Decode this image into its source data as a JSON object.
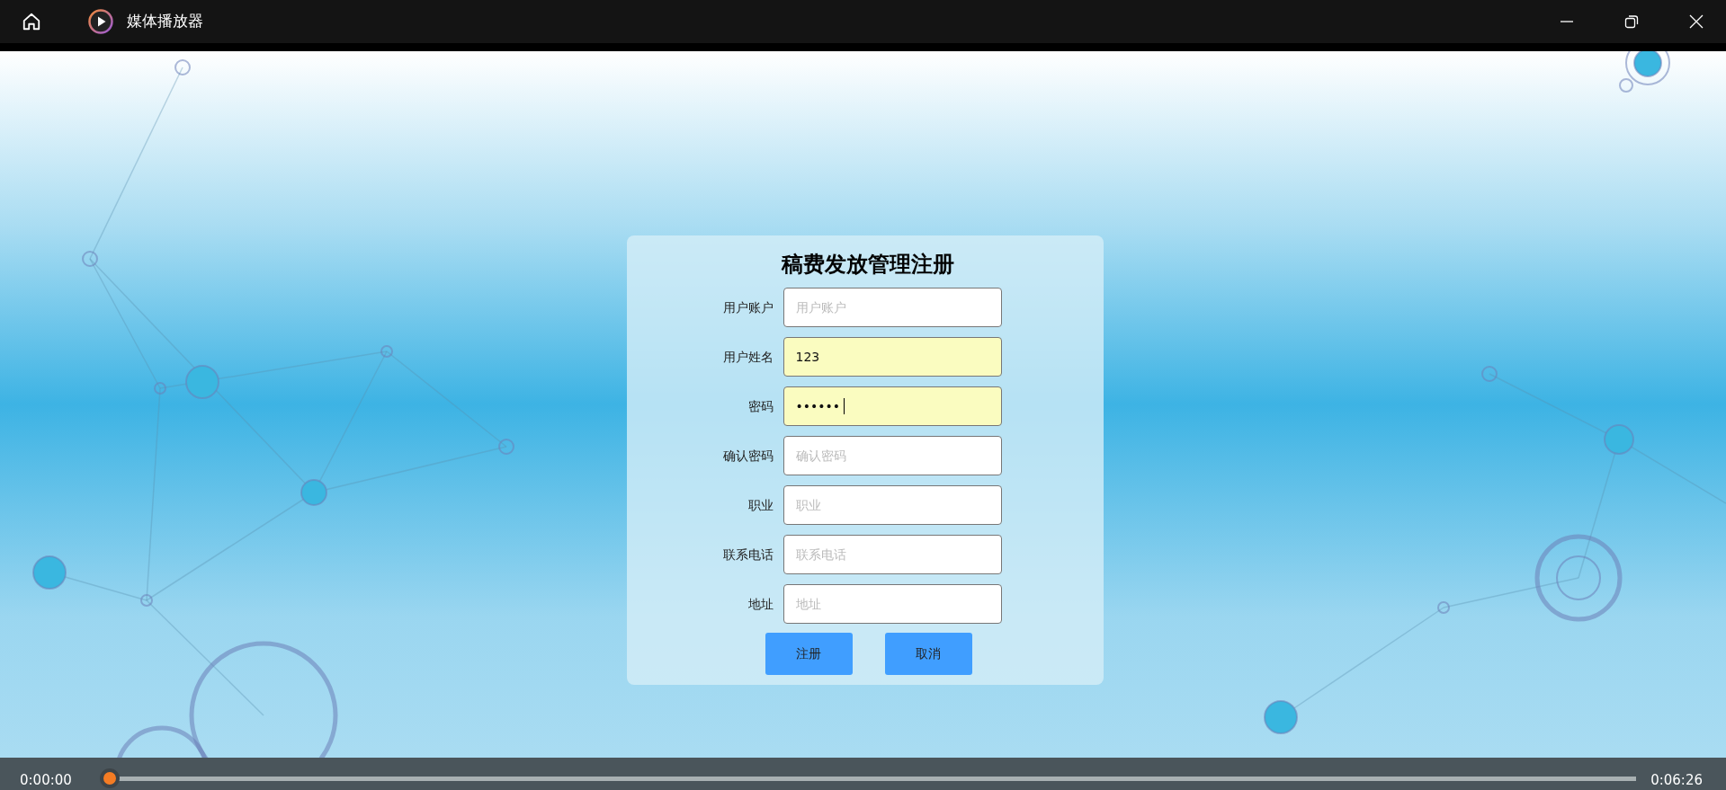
{
  "window": {
    "title": "媒体播放器"
  },
  "form": {
    "title": "稿费发放管理注册",
    "fields": [
      {
        "label": "用户账户",
        "placeholder": "用户账户",
        "autofilled": false
      },
      {
        "label": "用户姓名",
        "value": "123",
        "autofilled": true
      },
      {
        "label": "密码",
        "value": "••••••",
        "autofilled": true,
        "focused": true
      },
      {
        "label": "确认密码",
        "placeholder": "确认密码",
        "autofilled": false
      },
      {
        "label": "职业",
        "placeholder": "职业",
        "autofilled": false
      },
      {
        "label": "联系电话",
        "placeholder": "联系电话",
        "autofilled": false
      },
      {
        "label": "地址",
        "placeholder": "地址",
        "autofilled": false
      }
    ],
    "buttons": [
      "注册",
      "取消"
    ]
  },
  "player": {
    "current_time": "0:00:00",
    "total_time": "0:06:26",
    "level": 0
  }
}
